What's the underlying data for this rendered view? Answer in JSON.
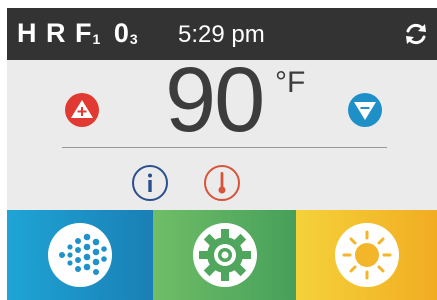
{
  "status": {
    "code_parts": [
      "H",
      "R",
      "F",
      "1",
      "0",
      "3"
    ],
    "time": "5:29 pm"
  },
  "temperature": {
    "value": "90",
    "unit": "°F"
  },
  "icons": {
    "sync": "sync-icon",
    "up": "temperature-up-icon",
    "down": "temperature-down-icon",
    "info": "info-icon",
    "thermometer": "thermometer-icon",
    "jets": "jets-icon",
    "settings": "gear-icon",
    "light": "sun-icon"
  },
  "colors": {
    "topbar": "#333333",
    "up_button": "#e03a32",
    "down_button": "#1f8fc8",
    "info": "#2a4f8f",
    "thermometer": "#d9533a",
    "jets_tile": "#1a8fc4",
    "settings_tile": "#5aae5e",
    "light_tile": "#f3c02c"
  }
}
